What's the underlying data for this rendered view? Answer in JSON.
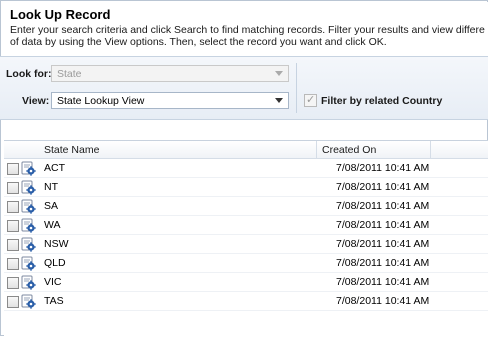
{
  "dialog": {
    "title": "Look Up Record",
    "description_line1": "Enter your search criteria and click Search to find matching records. Filter your results and view differe",
    "description_line2": "of data by using the View options. Then, select the record you want and click OK."
  },
  "criteria": {
    "look_for_label": "Look for:",
    "look_for_value": "State",
    "view_label": "View:",
    "view_value": "State Lookup View",
    "filter_label": "Filter by related Country",
    "filter_checked": true,
    "filter_check_glyph": "✓"
  },
  "grid": {
    "columns": [
      "State Name",
      "Created On"
    ],
    "rows": [
      {
        "name": "ACT",
        "created": "7/08/2011 10:41 AM"
      },
      {
        "name": "NT",
        "created": "7/08/2011 10:41 AM"
      },
      {
        "name": "SA",
        "created": "7/08/2011 10:41 AM"
      },
      {
        "name": "WA",
        "created": "7/08/2011 10:41 AM"
      },
      {
        "name": "NSW",
        "created": "7/08/2011 10:41 AM"
      },
      {
        "name": "QLD",
        "created": "7/08/2011 10:41 AM"
      },
      {
        "name": "VIC",
        "created": "7/08/2011 10:41 AM"
      },
      {
        "name": "TAS",
        "created": "7/08/2011 10:41 AM"
      }
    ],
    "row_icon": "record-gear-icon"
  },
  "colors": {
    "border": "#b9c5d3",
    "criteria_bg": "#e7edf5",
    "icon_blue": "#2a5ea8"
  }
}
